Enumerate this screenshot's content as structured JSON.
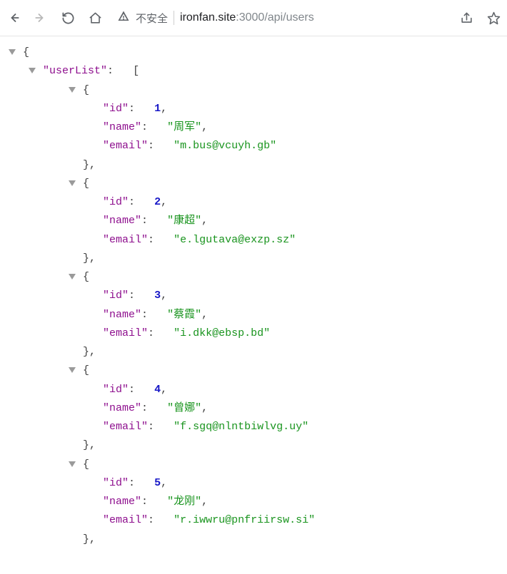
{
  "toolbar": {
    "security_label": "不安全",
    "url": {
      "host": "ironfan.site",
      "port": ":3000",
      "path": "/api/users"
    }
  },
  "json": {
    "root_key": "userList",
    "keys": {
      "id": "id",
      "name": "name",
      "email": "email"
    },
    "users": [
      {
        "id": "1",
        "name": "周军",
        "email": "m.bus@vcuyh.gb"
      },
      {
        "id": "2",
        "name": "康超",
        "email": "e.lgutava@exzp.sz"
      },
      {
        "id": "3",
        "name": "蔡霞",
        "email": "i.dkk@ebsp.bd"
      },
      {
        "id": "4",
        "name": "曾娜",
        "email": "f.sgq@nlntbiwlvg.uy"
      },
      {
        "id": "5",
        "name": "龙刚",
        "email": "r.iwwru@pnfriirsw.si"
      }
    ]
  }
}
